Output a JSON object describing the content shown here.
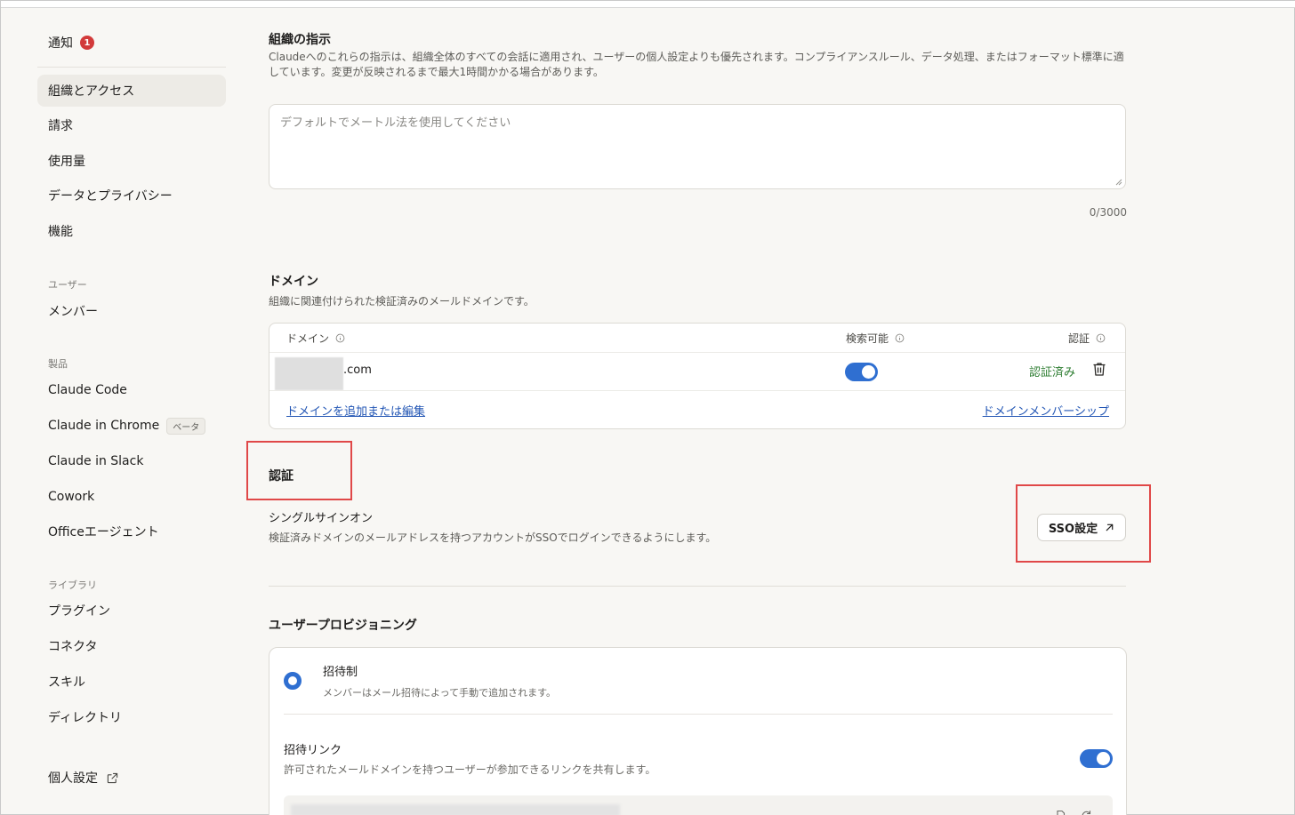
{
  "sidebar": {
    "notifications": {
      "label": "通知",
      "badge": "1"
    },
    "items": [
      {
        "label": "組織とアクセス"
      },
      {
        "label": "請求"
      },
      {
        "label": "使用量"
      },
      {
        "label": "データとプライバシー"
      },
      {
        "label": "機能"
      }
    ],
    "sections": {
      "users": {
        "heading": "ユーザー",
        "items": [
          "メンバー"
        ]
      },
      "products": {
        "heading": "製品",
        "items": [
          "Claude Code",
          "Claude in Chrome",
          "Claude in Slack",
          "Cowork",
          "Officeエージェント"
        ],
        "beta_label": "ベータ"
      },
      "library": {
        "heading": "ライブラリ",
        "items": [
          "プラグイン",
          "コネクタ",
          "スキル",
          "ディレクトリ"
        ]
      }
    },
    "personal_settings": "個人設定"
  },
  "instructions": {
    "title": "組織の指示",
    "description": "Claudeへのこれらの指示は、組織全体のすべての会話に適用され、ユーザーの個人設定よりも優先されます。コンプライアンスルール、データ処理、またはフォーマット標準に適しています。変更が反映されるまで最大1時間かかる場合があります。",
    "placeholder": "デフォルトでメートル法を使用してください",
    "counter": "0/3000"
  },
  "domains": {
    "title": "ドメイン",
    "description": "組織に関連付けられた検証済みのメールドメインです。",
    "columns": {
      "domain": "ドメイン",
      "searchable": "検索可能",
      "verification": "認証"
    },
    "rows": [
      {
        "domain_suffix": ".com",
        "searchable": true,
        "status": "認証済み"
      }
    ],
    "add_edit_link": "ドメインを追加または編集",
    "membership_link": "ドメインメンバーシップ"
  },
  "auth": {
    "title": "認証",
    "sso_title": "シングルサインオン",
    "sso_description": "検証済みドメインのメールアドレスを持つアカウントがSSOでログインできるようにします。",
    "sso_button": "SSO設定"
  },
  "provisioning": {
    "title": "ユーザープロビジョニング",
    "invite_only": {
      "title": "招待制",
      "description": "メンバーはメール招待によって手動で追加されます。",
      "selected": true
    },
    "invite_link": {
      "title": "招待リンク",
      "description": "許可されたメールドメインを持つユーザーが参加できるリンクを共有します。",
      "enabled": true
    }
  },
  "colors": {
    "accent": "#2f6fd1",
    "verified": "#2e7d32",
    "highlight": "#e04848",
    "link": "#2457b5"
  }
}
